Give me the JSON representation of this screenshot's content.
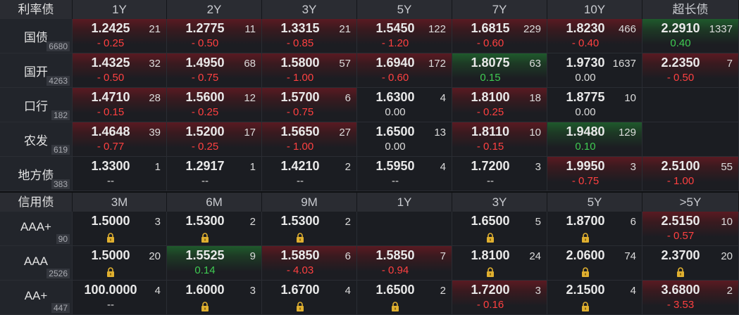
{
  "rates": {
    "header": [
      "利率债",
      "1Y",
      "2Y",
      "3Y",
      "5Y",
      "7Y",
      "10Y",
      "超长债"
    ],
    "rows": [
      {
        "name": "国债",
        "count": "6680",
        "cells": [
          {
            "price": "1.2425",
            "vol": "21",
            "chg": "- 0.25",
            "dir": "neg",
            "bg": "red"
          },
          {
            "price": "1.2775",
            "vol": "11",
            "chg": "- 0.50",
            "dir": "neg",
            "bg": "red"
          },
          {
            "price": "1.3315",
            "vol": "21",
            "chg": "- 0.85",
            "dir": "neg",
            "bg": "red"
          },
          {
            "price": "1.5450",
            "vol": "122",
            "chg": "- 1.20",
            "dir": "neg",
            "bg": "red"
          },
          {
            "price": "1.6815",
            "vol": "229",
            "chg": "- 0.60",
            "dir": "neg",
            "bg": "red"
          },
          {
            "price": "1.8230",
            "vol": "466",
            "chg": "- 0.40",
            "dir": "neg",
            "bg": "red"
          },
          {
            "price": "2.2910",
            "vol": "1337",
            "chg": "0.40",
            "dir": "pos",
            "bg": "green"
          }
        ]
      },
      {
        "name": "国开",
        "count": "4263",
        "cells": [
          {
            "price": "1.4325",
            "vol": "32",
            "chg": "- 0.50",
            "dir": "neg",
            "bg": "red"
          },
          {
            "price": "1.4950",
            "vol": "68",
            "chg": "- 0.75",
            "dir": "neg",
            "bg": "red"
          },
          {
            "price": "1.5800",
            "vol": "57",
            "chg": "- 1.00",
            "dir": "neg",
            "bg": "red"
          },
          {
            "price": "1.6940",
            "vol": "172",
            "chg": "- 0.60",
            "dir": "neg",
            "bg": "red"
          },
          {
            "price": "1.8075",
            "vol": "63",
            "chg": "0.15",
            "dir": "pos",
            "bg": "green"
          },
          {
            "price": "1.9730",
            "vol": "1637",
            "chg": "0.00",
            "dir": "flat",
            "bg": "none"
          },
          {
            "price": "2.2350",
            "vol": "7",
            "chg": "- 0.50",
            "dir": "neg",
            "bg": "red"
          }
        ]
      },
      {
        "name": "口行",
        "count": "182",
        "cells": [
          {
            "price": "1.4710",
            "vol": "28",
            "chg": "- 0.15",
            "dir": "neg",
            "bg": "red"
          },
          {
            "price": "1.5600",
            "vol": "12",
            "chg": "- 0.25",
            "dir": "neg",
            "bg": "red"
          },
          {
            "price": "1.5700",
            "vol": "6",
            "chg": "- 0.75",
            "dir": "neg",
            "bg": "red"
          },
          {
            "price": "1.6300",
            "vol": "4",
            "chg": "0.00",
            "dir": "flat",
            "bg": "none"
          },
          {
            "price": "1.8100",
            "vol": "18",
            "chg": "- 0.25",
            "dir": "neg",
            "bg": "red"
          },
          {
            "price": "1.8775",
            "vol": "10",
            "chg": "0.00",
            "dir": "flat",
            "bg": "none"
          },
          {
            "price": "",
            "vol": "",
            "chg": "",
            "dir": "flat",
            "bg": "none"
          }
        ]
      },
      {
        "name": "农发",
        "count": "619",
        "cells": [
          {
            "price": "1.4648",
            "vol": "39",
            "chg": "- 0.77",
            "dir": "neg",
            "bg": "red"
          },
          {
            "price": "1.5200",
            "vol": "17",
            "chg": "- 0.25",
            "dir": "neg",
            "bg": "red"
          },
          {
            "price": "1.5650",
            "vol": "27",
            "chg": "- 1.00",
            "dir": "neg",
            "bg": "red"
          },
          {
            "price": "1.6500",
            "vol": "13",
            "chg": "0.00",
            "dir": "flat",
            "bg": "none"
          },
          {
            "price": "1.8110",
            "vol": "10",
            "chg": "- 0.15",
            "dir": "neg",
            "bg": "red"
          },
          {
            "price": "1.9480",
            "vol": "129",
            "chg": "0.10",
            "dir": "pos",
            "bg": "green"
          },
          {
            "price": "",
            "vol": "",
            "chg": "",
            "dir": "flat",
            "bg": "none"
          }
        ]
      },
      {
        "name": "地方债",
        "count": "383",
        "cells": [
          {
            "price": "1.3300",
            "vol": "1",
            "chg": "--",
            "dir": "flat",
            "bg": "none"
          },
          {
            "price": "1.2917",
            "vol": "1",
            "chg": "--",
            "dir": "flat",
            "bg": "none"
          },
          {
            "price": "1.4210",
            "vol": "2",
            "chg": "--",
            "dir": "flat",
            "bg": "none"
          },
          {
            "price": "1.5950",
            "vol": "4",
            "chg": "--",
            "dir": "flat",
            "bg": "none"
          },
          {
            "price": "1.7200",
            "vol": "3",
            "chg": "--",
            "dir": "flat",
            "bg": "none"
          },
          {
            "price": "1.9950",
            "vol": "3",
            "chg": "- 0.75",
            "dir": "neg",
            "bg": "red"
          },
          {
            "price": "2.5100",
            "vol": "55",
            "chg": "- 1.00",
            "dir": "neg",
            "bg": "red"
          }
        ]
      }
    ]
  },
  "credit": {
    "header": [
      "信用债",
      "3M",
      "6M",
      "9M",
      "1Y",
      "3Y",
      "5Y",
      ">5Y"
    ],
    "rows": [
      {
        "name": "AAA+",
        "count": "90",
        "cells": [
          {
            "price": "1.5000",
            "vol": "3",
            "chg": "lock",
            "dir": "flat",
            "bg": "none"
          },
          {
            "price": "1.5300",
            "vol": "2",
            "chg": "lock",
            "dir": "flat",
            "bg": "none"
          },
          {
            "price": "1.5300",
            "vol": "2",
            "chg": "lock",
            "dir": "flat",
            "bg": "none"
          },
          {
            "price": "",
            "vol": "",
            "chg": "",
            "dir": "flat",
            "bg": "none"
          },
          {
            "price": "1.6500",
            "vol": "5",
            "chg": "lock",
            "dir": "flat",
            "bg": "none"
          },
          {
            "price": "1.8700",
            "vol": "6",
            "chg": "lock",
            "dir": "flat",
            "bg": "none"
          },
          {
            "price": "2.5150",
            "vol": "10",
            "chg": "- 0.57",
            "dir": "neg",
            "bg": "red"
          }
        ]
      },
      {
        "name": "AAA",
        "count": "2526",
        "cells": [
          {
            "price": "1.5000",
            "vol": "20",
            "chg": "lock",
            "dir": "flat",
            "bg": "none"
          },
          {
            "price": "1.5525",
            "vol": "9",
            "chg": "0.14",
            "dir": "pos",
            "bg": "green"
          },
          {
            "price": "1.5850",
            "vol": "6",
            "chg": "- 4.03",
            "dir": "neg",
            "bg": "red"
          },
          {
            "price": "1.5850",
            "vol": "7",
            "chg": "- 0.94",
            "dir": "neg",
            "bg": "red"
          },
          {
            "price": "1.8100",
            "vol": "24",
            "chg": "lock",
            "dir": "flat",
            "bg": "none"
          },
          {
            "price": "2.0600",
            "vol": "74",
            "chg": "lock",
            "dir": "flat",
            "bg": "none"
          },
          {
            "price": "2.3700",
            "vol": "20",
            "chg": "lock",
            "dir": "flat",
            "bg": "none"
          }
        ]
      },
      {
        "name": "AA+",
        "count": "447",
        "cells": [
          {
            "price": "100.0000",
            "vol": "4",
            "chg": "--",
            "dir": "flat",
            "bg": "none"
          },
          {
            "price": "1.6000",
            "vol": "3",
            "chg": "lock",
            "dir": "flat",
            "bg": "none"
          },
          {
            "price": "1.6700",
            "vol": "4",
            "chg": "lock",
            "dir": "flat",
            "bg": "none"
          },
          {
            "price": "1.6500",
            "vol": "2",
            "chg": "lock",
            "dir": "flat",
            "bg": "none"
          },
          {
            "price": "1.7200",
            "vol": "3",
            "chg": "- 0.16",
            "dir": "neg",
            "bg": "red"
          },
          {
            "price": "2.1500",
            "vol": "4",
            "chg": "lock",
            "dir": "flat",
            "bg": "none"
          },
          {
            "price": "3.6800",
            "vol": "2",
            "chg": "- 3.53",
            "dir": "neg",
            "bg": "red"
          }
        ]
      }
    ]
  }
}
